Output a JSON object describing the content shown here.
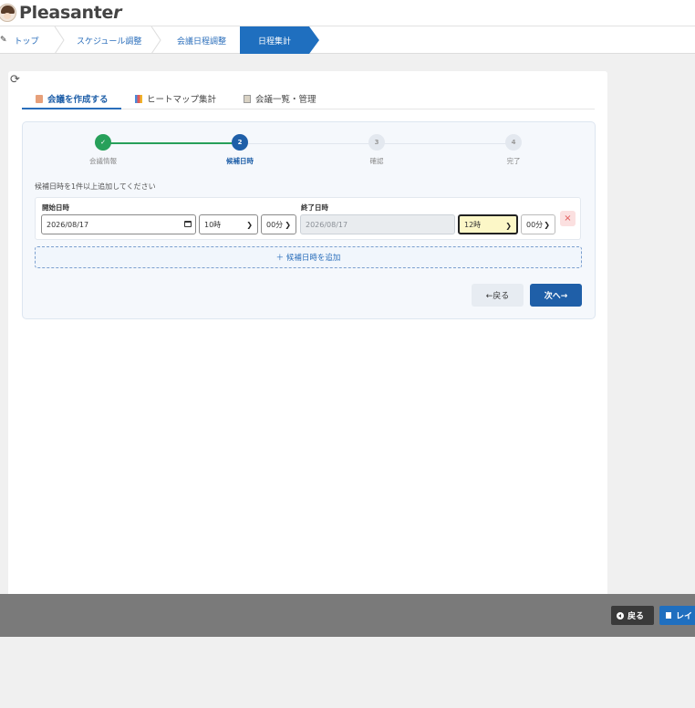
{
  "app": {
    "logo_text": "Pleasante",
    "logo_flair": "r"
  },
  "breadcrumb": {
    "items": [
      "トップ",
      "スケジュール調整",
      "会議日程調整",
      "日程集計"
    ],
    "active_index": 3
  },
  "tabs": [
    {
      "label": "会議を作成する",
      "icon": "memo-icon",
      "active": true
    },
    {
      "label": "ヒートマップ集計",
      "icon": "chart-icon",
      "active": false
    },
    {
      "label": "会議一覧・管理",
      "icon": "clipboard-icon",
      "active": false
    }
  ],
  "wizard": {
    "steps": [
      {
        "number": "✓",
        "label": "会議情報",
        "state": "done"
      },
      {
        "number": "2",
        "label": "候補日時",
        "state": "current"
      },
      {
        "number": "3",
        "label": "確認",
        "state": "pending"
      },
      {
        "number": "4",
        "label": "完了",
        "state": "pending"
      }
    ],
    "hint": "候補日時を1件以上追加してください",
    "start_label": "開始日時",
    "end_label": "終了日時",
    "start_date": "2026/08/17",
    "start_hour": "10時",
    "start_minute": "00分",
    "end_date": "2026/08/17",
    "end_hour": "12時",
    "end_minute": "00分",
    "remove_symbol": "×",
    "add_label": "＋ 候補日時を追加",
    "back_label": "←戻る",
    "next_label": "次へ→"
  },
  "bottom": {
    "back_label": "戻る",
    "layout_label": "レイ"
  },
  "colors": {
    "accent": "#1f5fa8",
    "done": "#27a05a",
    "highlight": "#fcf7c7"
  }
}
